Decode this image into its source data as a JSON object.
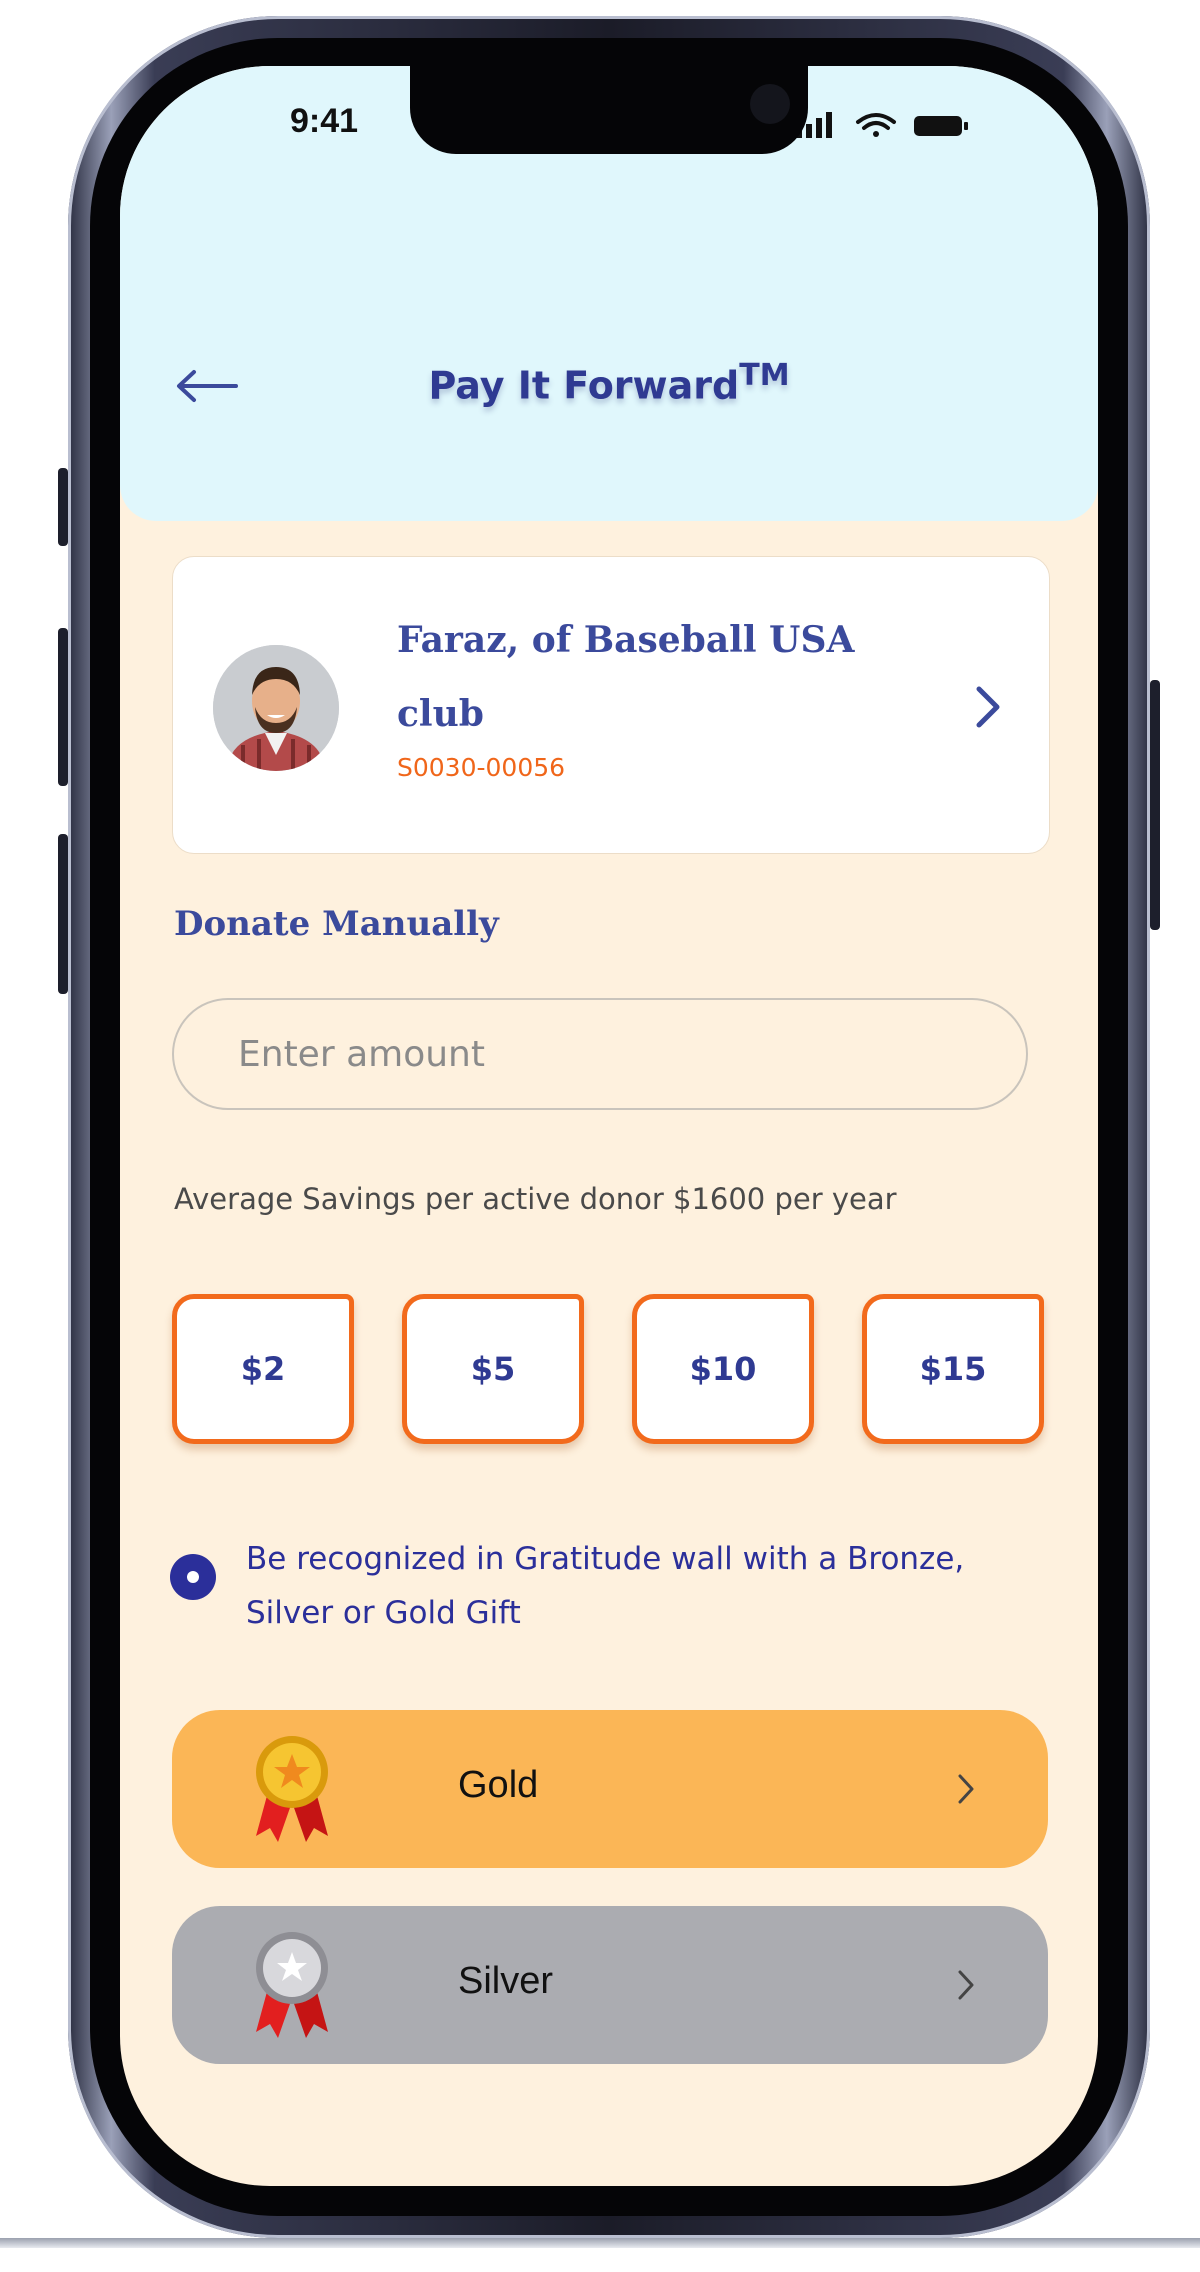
{
  "status_bar": {
    "time": "9:41"
  },
  "header": {
    "title": "Pay It Forward",
    "trademark": "TM"
  },
  "club_card": {
    "name": "Faraz, of Baseball USA club",
    "code": "S0030-00056"
  },
  "donate": {
    "section_title": "Donate Manually",
    "amount_placeholder": "Enter amount",
    "savings_text": "Average Savings per active donor $1600 per year",
    "quick_amounts": [
      "$2",
      "$5",
      "$10",
      "$15"
    ]
  },
  "recognition": {
    "text": "Be recognized in Gratitude wall with a Bronze, Silver or Gold Gift"
  },
  "tiers": [
    {
      "label": "Gold",
      "color": "#fbb656"
    },
    {
      "label": "Silver",
      "color": "#abacb1"
    }
  ],
  "colors": {
    "header_bg": "#e0f7fc",
    "page_bg": "#fef1de",
    "accent_blue": "#2f3a92",
    "accent_orange": "#f26a1c"
  }
}
